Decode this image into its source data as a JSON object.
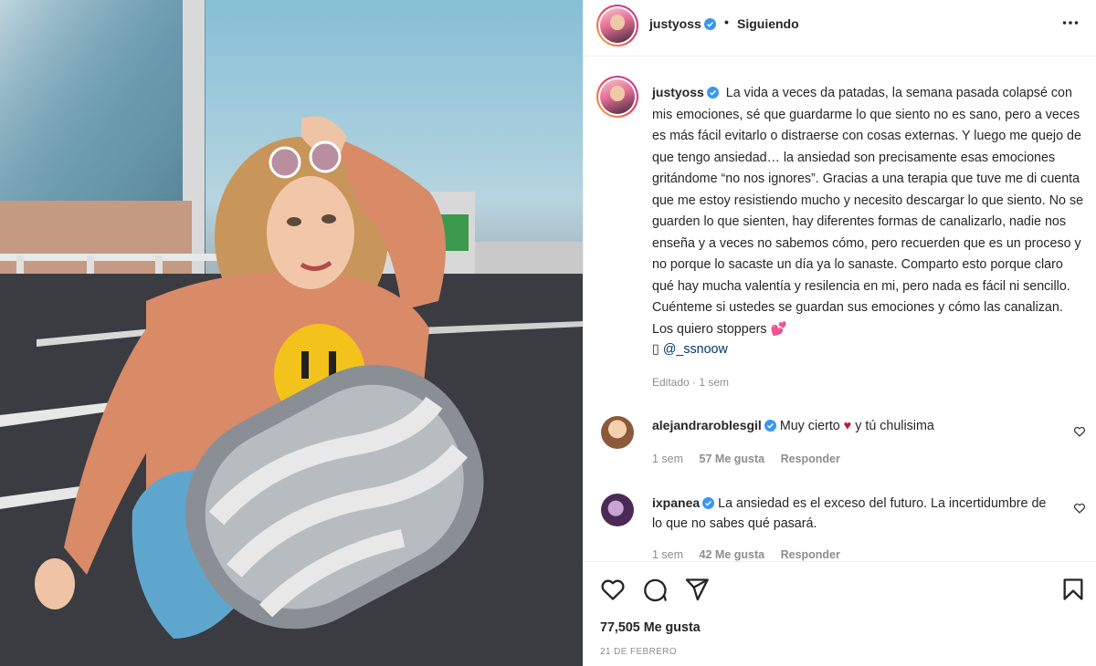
{
  "colors": {
    "text": "#262626",
    "muted": "#8e8e8e",
    "link": "#00376b",
    "verified": "#3897f0",
    "border": "#efefef"
  },
  "photo": {
    "description_icon": "post-photo"
  },
  "header": {
    "username": "justyoss",
    "separator": "•",
    "follow_label": "Siguiendo",
    "more_icon": "more-horizontal-icon"
  },
  "caption": {
    "username": "justyoss",
    "text": "La vida a veces da patadas, la semana pasada colapsé con mis emociones, sé que guardarme lo que siento no es sano, pero a veces es más fácil evitarlo o distraerse con cosas externas. Y luego me quejo de que tengo ansiedad… la ansiedad son precisamente esas emociones gritándome “no nos ignores”. Gracias a una terapia que tuve me di cuenta que me estoy resistiendo mucho y necesito descargar lo que siento. No se guarden lo que sienten, hay diferentes formas de canalizarlo, nadie nos enseña y a veces no sabemos cómo, pero recuerden que es un proceso y no porque lo sacaste un día ya lo sanaste. Comparto esto porque claro qué hay mucha valentía y resilencia en mi, pero nada es fácil ni sencillo. Cuénteme si ustedes se guardan sus emociones y cómo las canalizan. Los quiero stoppers",
    "emoji": "💕",
    "tag_prefix": "▯",
    "tag": "@_ssnoow",
    "edited": "Editado · 1 sem"
  },
  "comments": [
    {
      "username": "alejandraroblesgil",
      "text_before": "Muy cierto",
      "emoji": "♥",
      "text_after": "y tú chulisima",
      "time": "1 sem",
      "likes": "57 Me gusta",
      "reply": "Responder"
    },
    {
      "username": "ixpanea",
      "text": "La ansiedad es el exceso del futuro. La incertidumbre de lo que no sabes qué pasará.",
      "time": "1 sem",
      "likes": "42 Me gusta",
      "reply": "Responder"
    }
  ],
  "actions": {
    "like_icon": "heart-icon",
    "comment_icon": "comment-icon",
    "share_icon": "share-icon",
    "save_icon": "bookmark-icon",
    "likes": "77,505 Me gusta",
    "date": "21 DE FEBRERO"
  }
}
